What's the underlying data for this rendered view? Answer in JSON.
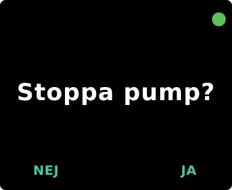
{
  "prompt": {
    "question": "Stoppa pump?"
  },
  "buttons": {
    "cancel_label": "NEJ",
    "confirm_label": "JA"
  },
  "colors": {
    "screen_background": "#000000",
    "text": "#ffffff",
    "button_text": "#4fc49a",
    "status_indicator": "#5cc05c"
  },
  "icons": {
    "status": "status-dot-icon"
  }
}
